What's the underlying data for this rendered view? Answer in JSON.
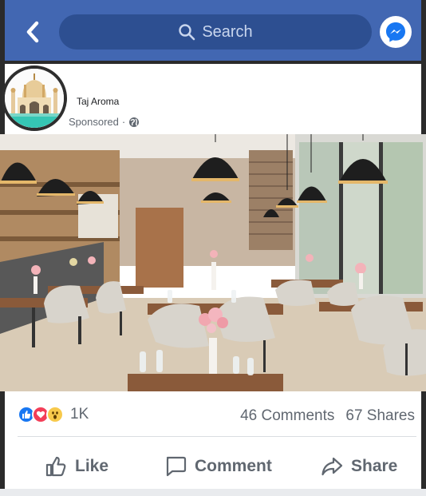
{
  "topbar": {
    "search_placeholder": "Search",
    "back_icon": "chevron-left-icon",
    "messenger_icon": "messenger-icon",
    "bg_color": "#4267b2"
  },
  "post": {
    "page_name": "Taj Aroma",
    "sponsored_label": "Sponsored",
    "separator": "·",
    "globe_icon": "globe-icon"
  },
  "stats": {
    "reaction_count": "1K",
    "comments": "46 Comments",
    "shares": "67 Shares",
    "reactions": [
      "like-reaction-icon",
      "love-reaction-icon",
      "wow-reaction-icon"
    ]
  },
  "actions": {
    "like": "Like",
    "comment": "Comment",
    "share": "Share"
  }
}
